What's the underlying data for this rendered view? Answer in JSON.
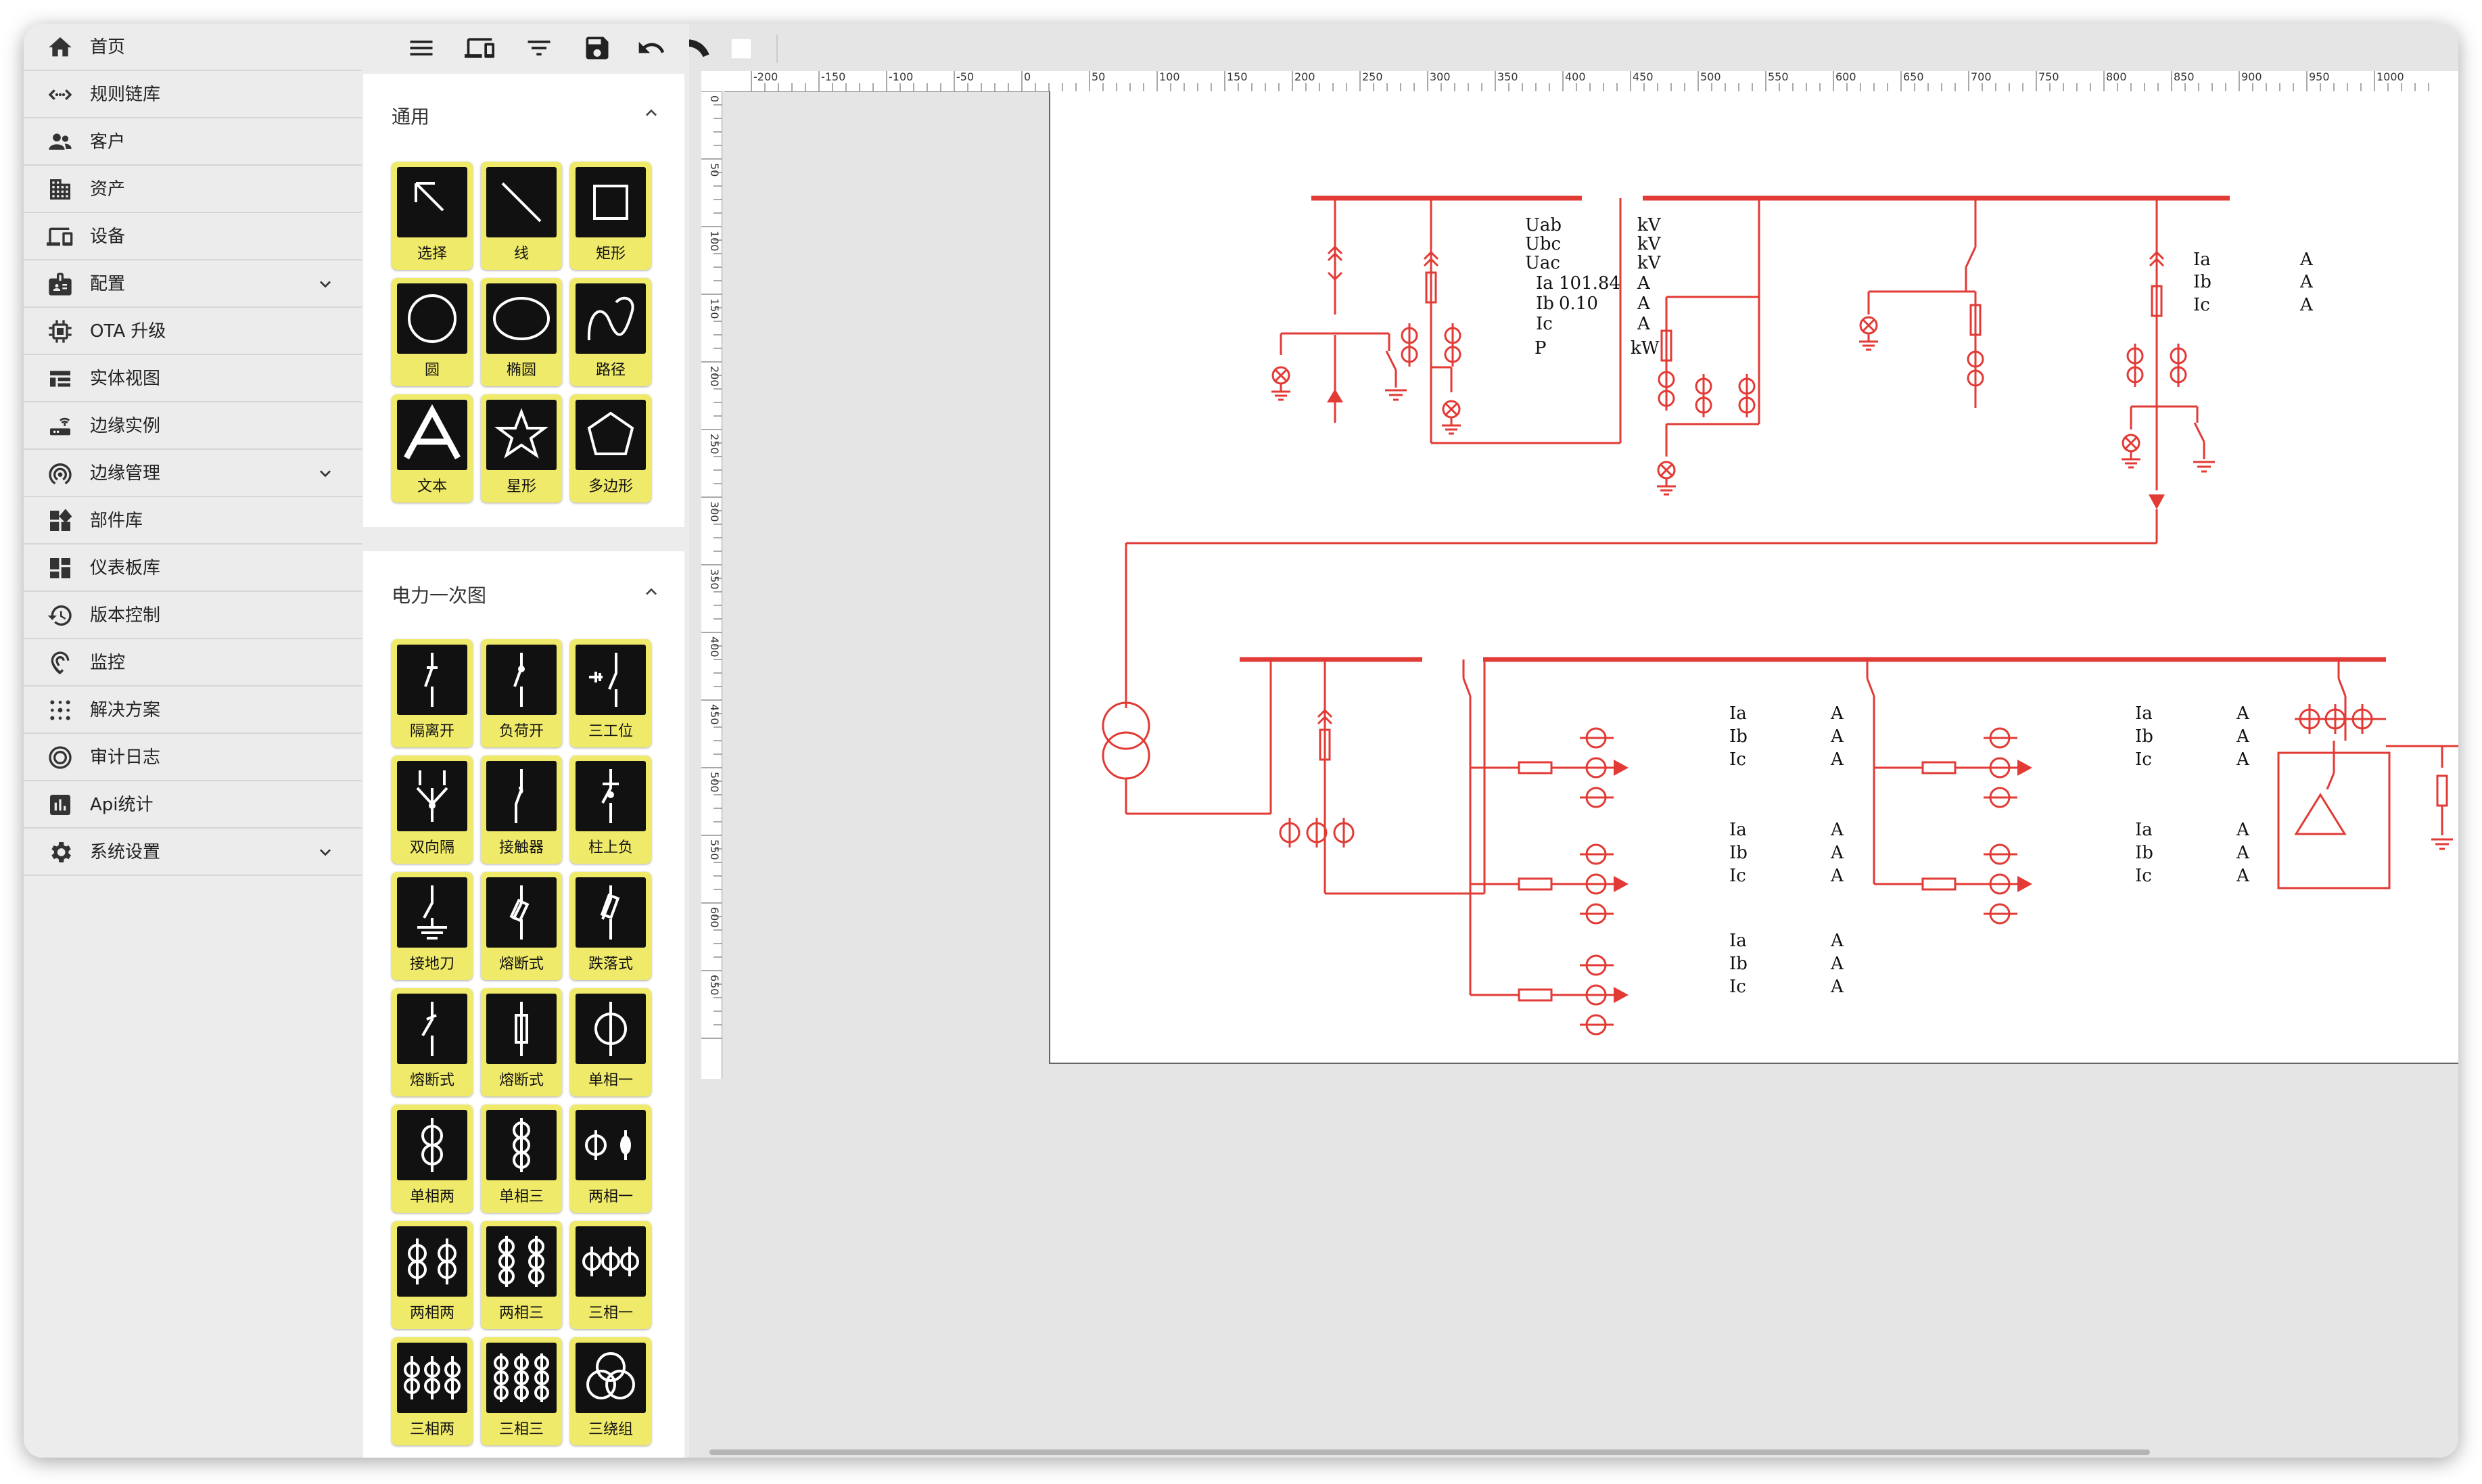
{
  "sidebar": {
    "items": [
      {
        "label": "首页",
        "icon": "home-icon"
      },
      {
        "label": "规则链库",
        "icon": "rule-chain-icon"
      },
      {
        "label": "客户",
        "icon": "customers-icon"
      },
      {
        "label": "资产",
        "icon": "assets-icon"
      },
      {
        "label": "设备",
        "icon": "devices-icon"
      },
      {
        "label": "配置",
        "icon": "profiles-icon",
        "expandable": true
      },
      {
        "label": "OTA 升级",
        "icon": "ota-chip-icon"
      },
      {
        "label": "实体视图",
        "icon": "entity-view-icon"
      },
      {
        "label": "边缘实例",
        "icon": "edge-router-icon"
      },
      {
        "label": "边缘管理",
        "icon": "edge-antenna-icon",
        "expandable": true
      },
      {
        "label": "部件库",
        "icon": "widgets-icon"
      },
      {
        "label": "仪表板库",
        "icon": "dashboards-icon"
      },
      {
        "label": "版本控制",
        "icon": "version-history-icon"
      },
      {
        "label": "监控",
        "icon": "monitoring-icon"
      },
      {
        "label": "解决方案",
        "icon": "solutions-icon"
      },
      {
        "label": "审计日志",
        "icon": "audit-log-icon"
      },
      {
        "label": "Api统计",
        "icon": "api-stats-icon"
      },
      {
        "label": "系统设置",
        "icon": "settings-gear-icon",
        "expandable": true
      }
    ]
  },
  "toolbar": {
    "buttons": [
      "menu-icon",
      "devices-view-icon",
      "filter-icon",
      "save-icon",
      "undo-icon",
      "redo-icon"
    ],
    "color_swatch": "#ffffff"
  },
  "palette": {
    "general": {
      "title": "通用",
      "tools": [
        "选择",
        "线",
        "矩形",
        "圆",
        "椭圆",
        "路径",
        "文本",
        "星形",
        "多边形"
      ]
    },
    "power": {
      "title": "电力一次图",
      "tools": [
        "隔离开",
        "负荷开",
        "三工位",
        "双向隔",
        "接触器",
        "柱上负",
        "接地刀",
        "熔断式",
        "跌落式",
        "熔断式",
        "熔断式",
        "单相一",
        "单相两",
        "单相三",
        "两相一",
        "两相两",
        "两相三",
        "三相一",
        "三相两",
        "三相三",
        "三绕组"
      ]
    }
  },
  "ruler": {
    "top_labels": [
      "-200",
      "-150",
      "-100",
      "-50",
      "0",
      "50",
      "100",
      "150",
      "200",
      "250",
      "300",
      "350",
      "400",
      "450",
      "500",
      "550",
      "600",
      "650",
      "700",
      "750",
      "800",
      "850",
      "900",
      "950",
      "1000"
    ],
    "left_labels": [
      "0",
      "50",
      "100",
      "150",
      "200",
      "250",
      "300",
      "350",
      "400",
      "450",
      "500",
      "550",
      "600",
      "650"
    ]
  },
  "diagram": {
    "stroke_color": "#e23a35",
    "meter1": {
      "labels": [
        "Uab",
        "Ubc",
        "Uac",
        "Ia",
        "Ib",
        "Ic",
        "P"
      ],
      "values": [
        "",
        "",
        "",
        "101.84",
        "0.10",
        "",
        ""
      ],
      "units": [
        "kV",
        "kV",
        "kV",
        "A",
        "A",
        "A",
        "kW"
      ]
    },
    "meter2": {
      "labels": [
        "Ia",
        "Ib",
        "Ic"
      ],
      "units": [
        "A",
        "A",
        "A"
      ]
    },
    "feeders": [
      {
        "labels": [
          "Ia",
          "Ib",
          "Ic"
        ],
        "units": [
          "A",
          "A",
          "A"
        ]
      },
      {
        "labels": [
          "Ia",
          "Ib",
          "Ic"
        ],
        "units": [
          "A",
          "A",
          "A"
        ]
      },
      {
        "labels": [
          "Ia",
          "Ib",
          "Ic"
        ],
        "units": [
          "A",
          "A",
          "A"
        ]
      },
      {
        "labels": [
          "Ia",
          "Ib",
          "Ic"
        ],
        "units": [
          "A",
          "A",
          "A"
        ]
      },
      {
        "labels": [
          "Ia",
          "Ib",
          "Ic"
        ],
        "units": [
          "A",
          "A",
          "A"
        ]
      }
    ]
  }
}
